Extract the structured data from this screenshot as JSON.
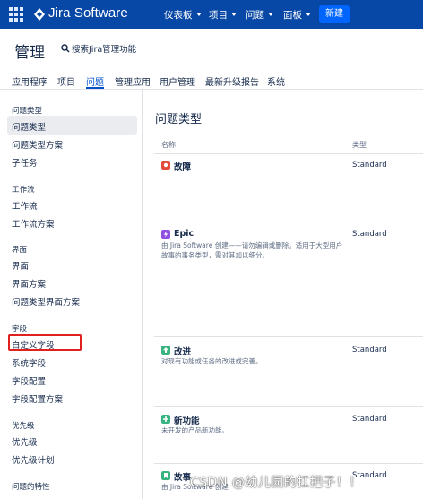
{
  "topbar": {
    "product_name": "Jira Software",
    "nav": [
      {
        "label": "仪表板"
      },
      {
        "label": "项目"
      },
      {
        "label": "问题"
      },
      {
        "label": "面板"
      }
    ],
    "create_label": "新建",
    "colors": {
      "background": "#0747a6",
      "create_button": "#0065ff"
    }
  },
  "header": {
    "title": "管理",
    "search_label": "搜索Jira管理功能",
    "tabs": [
      {
        "label": "应用程序"
      },
      {
        "label": "项目"
      },
      {
        "label": "问题"
      },
      {
        "label": "管理应用"
      },
      {
        "label": "用户管理"
      },
      {
        "label": "最新升级报告"
      },
      {
        "label": "系统"
      }
    ],
    "active_tab": "问题"
  },
  "sidebar": {
    "sections": [
      {
        "heading": "问题类型",
        "items": [
          "问题类型",
          "问题类型方案",
          "子任务"
        ]
      },
      {
        "heading": "工作流",
        "items": [
          "工作流",
          "工作流方案"
        ]
      },
      {
        "heading": "界面",
        "items": [
          "界面",
          "界面方案",
          "问题类型界面方案"
        ]
      },
      {
        "heading": "字段",
        "items": [
          "自定义字段",
          "系统字段",
          "字段配置",
          "字段配置方案"
        ]
      },
      {
        "heading": "优先级",
        "items": [
          "优先级",
          "优先级计划"
        ]
      },
      {
        "heading": "问题的特性",
        "items": []
      }
    ],
    "active_item": "问题类型",
    "highlighted_item": "自定义字段",
    "highlight_color": "#e0201d"
  },
  "main": {
    "title": "问题类型",
    "columns": {
      "name": "名称",
      "type": "类型"
    },
    "rows": [
      {
        "name": "故障",
        "description": "",
        "type": "Standard",
        "icon": "bug-icon",
        "icon_color": "#e5493a"
      },
      {
        "name": "Epic",
        "description": "由 Jira Software 创建——请勿编辑或删除。适用于大型用户故事的事务类型，需对其加以细分。",
        "type": "Standard",
        "icon": "epic-icon",
        "icon_color": "#904ee2"
      },
      {
        "name": "改进",
        "description": "对现有功能或任务的改进或完善。",
        "type": "Standard",
        "icon": "improvement-icon",
        "icon_color": "#36b37e"
      },
      {
        "name": "新功能",
        "description": "未开发的产品新功能。",
        "type": "Standard",
        "icon": "new-feature-icon",
        "icon_color": "#36b37e"
      },
      {
        "name": "故事",
        "description": "由 Jira Software 创建",
        "type": "Standard",
        "icon": "story-icon",
        "icon_color": "#36b37e"
      }
    ]
  },
  "watermark": "CSDN @幼儿园的扛把子！！"
}
